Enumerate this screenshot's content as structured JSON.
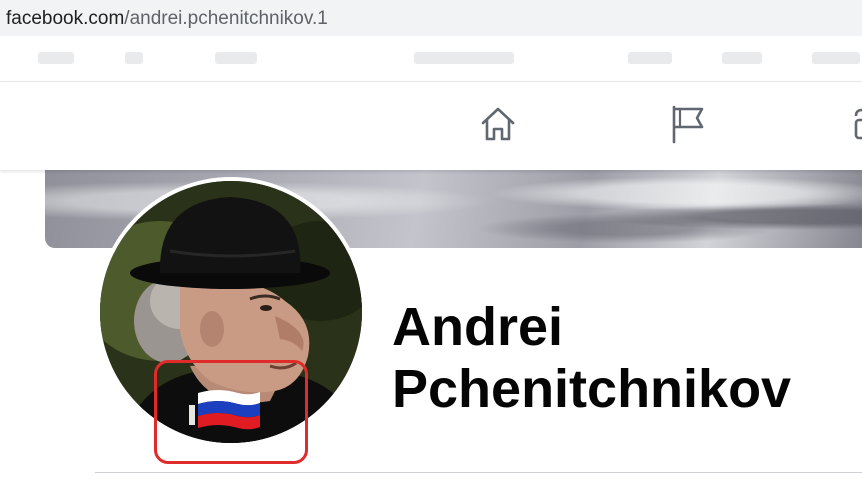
{
  "browser": {
    "url_host": "facebook.com",
    "url_path": "/andrei.pchenitchnikov.1"
  },
  "nav": {
    "icons": [
      "home-icon",
      "flag-icon",
      "marketplace-icon"
    ]
  },
  "profile": {
    "name_line1": "Andrei",
    "name_line2": "Pchenitchnikov"
  },
  "colors": {
    "highlight": "#e02b2b",
    "flag_white": "#ffffff",
    "flag_blue": "#1c3fbf",
    "flag_red": "#e11b22"
  }
}
